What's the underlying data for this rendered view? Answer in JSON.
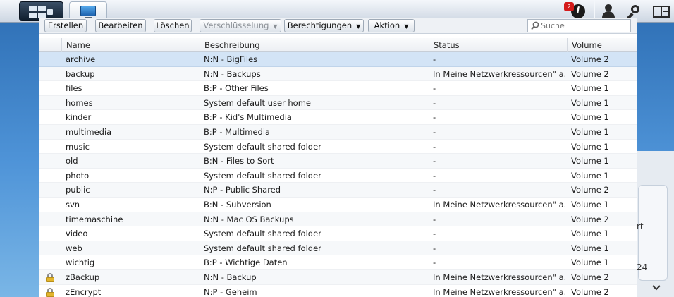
{
  "taskbar": {
    "notification_count": "2",
    "info_glyph": "i",
    "icons": [
      "main-menu-icon",
      "control-panel-icon",
      "info-icon",
      "user-icon",
      "search-icon",
      "widgets-icon"
    ]
  },
  "background": {
    "text1": "rt",
    "text2": "24"
  },
  "toolbar": {
    "create": "Erstellen",
    "edit": "Bearbeiten",
    "delete": "Löschen",
    "encryption": "Verschlüsselung",
    "permissions": "Berechtigungen",
    "action": "Aktion",
    "search_placeholder": "Suche"
  },
  "table": {
    "headers": {
      "name": "Name",
      "description": "Beschreibung",
      "status": "Status",
      "volume": "Volume"
    },
    "rows": [
      {
        "name": "archive",
        "description": "N:N - BigFiles",
        "status": "-",
        "volume": "Volume 2",
        "selected": true
      },
      {
        "name": "backup",
        "description": "N:N - Backups",
        "status": "In Meine Netzwerkressourcen\" a...",
        "volume": "Volume 2"
      },
      {
        "name": "files",
        "description": "B:P - Other Files",
        "status": "-",
        "volume": "Volume 1"
      },
      {
        "name": "homes",
        "description": "System default user home",
        "status": "-",
        "volume": "Volume 1"
      },
      {
        "name": "kinder",
        "description": "B:P - Kid's Multimedia",
        "status": "-",
        "volume": "Volume 1"
      },
      {
        "name": "multimedia",
        "description": "B:P - Multimedia",
        "status": "-",
        "volume": "Volume 1"
      },
      {
        "name": "music",
        "description": "System default shared folder",
        "status": "-",
        "volume": "Volume 1"
      },
      {
        "name": "old",
        "description": "B:N - Files to Sort",
        "status": "-",
        "volume": "Volume 1"
      },
      {
        "name": "photo",
        "description": "System default shared folder",
        "status": "-",
        "volume": "Volume 1"
      },
      {
        "name": "public",
        "description": "N:P - Public Shared",
        "status": "-",
        "volume": "Volume 2"
      },
      {
        "name": "svn",
        "description": "B:N - Subversion",
        "status": "In Meine Netzwerkressourcen\" a...",
        "volume": "Volume 1"
      },
      {
        "name": "timemaschine",
        "description": "N:N - Mac OS Backups",
        "status": "-",
        "volume": "Volume 2"
      },
      {
        "name": "video",
        "description": "System default shared folder",
        "status": "-",
        "volume": "Volume 1"
      },
      {
        "name": "web",
        "description": "System default shared folder",
        "status": "-",
        "volume": "Volume 1"
      },
      {
        "name": "wichtig",
        "description": "B:P - Wichtige Daten",
        "status": "-",
        "volume": "Volume 1"
      },
      {
        "name": "zBackup",
        "description": "N:N - Backup",
        "status": "In Meine Netzwerkressourcen\" a...",
        "volume": "Volume 2",
        "locked": true
      },
      {
        "name": "zEncrypt",
        "description": "N:P - Geheim",
        "status": "In Meine Netzwerkressourcen\" a...",
        "volume": "Volume 2",
        "locked": true
      }
    ]
  }
}
